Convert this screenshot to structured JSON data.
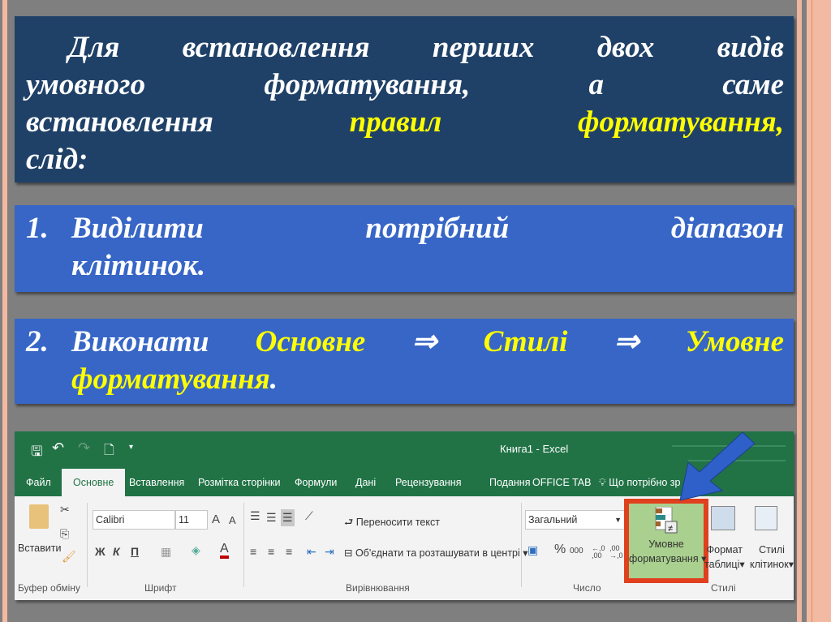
{
  "box1": {
    "l1": "Для встановлення перших двох видів",
    "l2": "умовного форматування, а саме",
    "l3a": "встановлення ",
    "l3b": "правил форматування",
    "l3c": ",",
    "l4": "слід:"
  },
  "step1": {
    "num": "1.",
    "l1": "Виділити потрібний діапазон",
    "l2": "клітинок."
  },
  "step2": {
    "num": "2.",
    "w1": "Виконати ",
    "w2": "Основне",
    "arrow1": " ⇒ ",
    "w3": "Стилі",
    "arrow2": " ⇒ ",
    "w4": "Умовне",
    "l2a": "форматування",
    "l2b": "."
  },
  "excel": {
    "title": "Книга1 - Excel",
    "qat": {
      "save": "🖫",
      "undo": "↶",
      "redo": "↷",
      "preview": "🗋",
      "customize": "▾"
    },
    "tabs": [
      "Файл",
      "Основне",
      "Вставлення",
      "Розмітка сторінки",
      "Формули",
      "Дані",
      "Рецензування",
      "Подання",
      "OFFICE TAB",
      "Що потрібно зр"
    ],
    "clipboard": {
      "paste": "Вставити",
      "group": "Буфер обміну"
    },
    "font": {
      "name": "Calibri",
      "size": "11",
      "bold": "Ж",
      "italic": "К",
      "underline": "П",
      "grow": "A",
      "shrink": "A",
      "color_a": "A",
      "group": "Шрифт"
    },
    "alignment": {
      "wrap": "Переносити текст",
      "merge": "Об'єднати та розташувати в центрі",
      "group": "Вирівнювання"
    },
    "number": {
      "format": "Загальний",
      "percent": "%",
      "thousands": "000",
      "inc": "←,0 ,00",
      "dec": ",00 →,0",
      "group": "Число"
    },
    "styles": {
      "conditional_l1": "Умовне",
      "conditional_l2": "форматування",
      "format_table_l1": "Формат",
      "format_table_l2": "таблиці",
      "cell_styles_l1": "Стилі",
      "cell_styles_l2": "клітинок",
      "group": "Стилі"
    },
    "colors": {
      "green": "#217346",
      "highlight": "#e0401e",
      "active": "#a9d08e"
    }
  }
}
